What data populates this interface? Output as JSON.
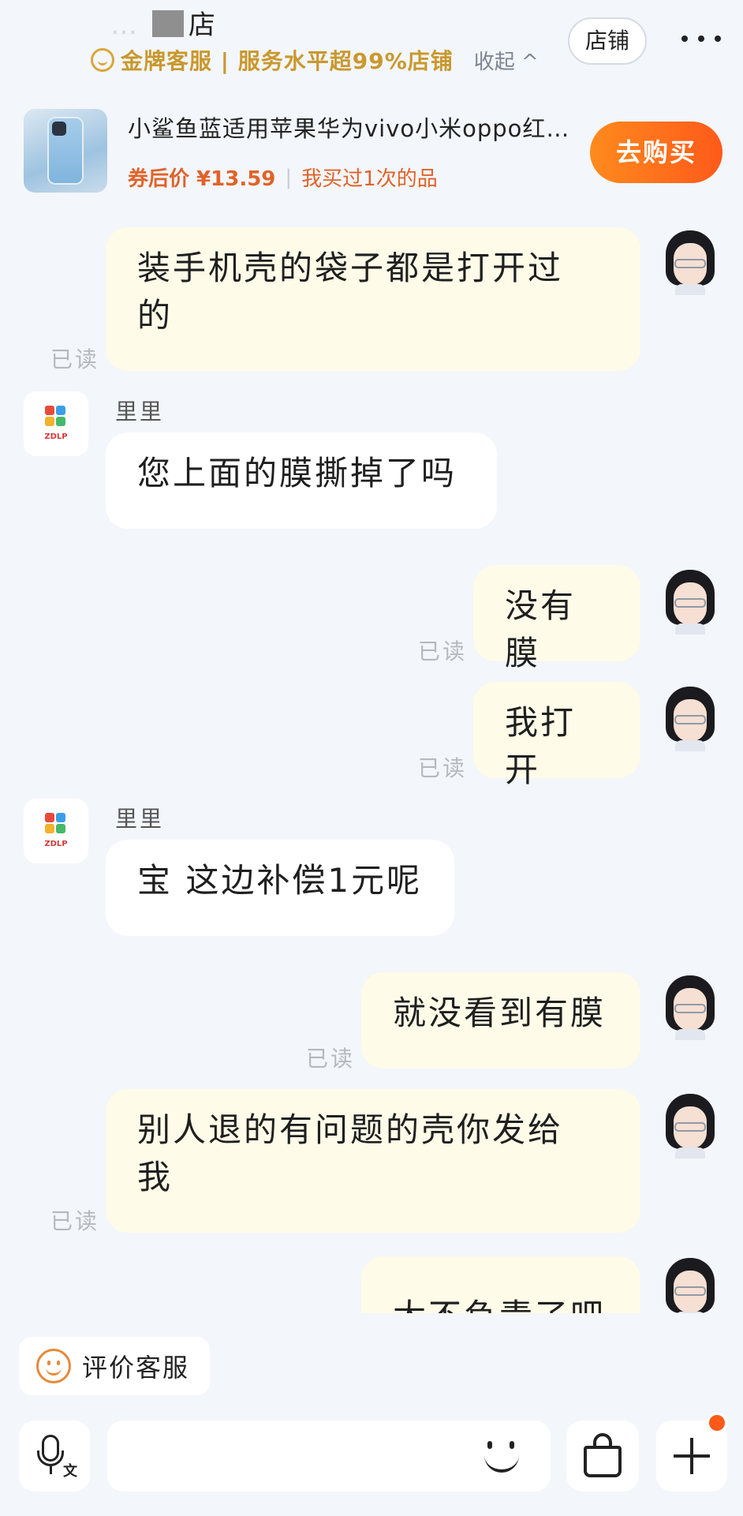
{
  "header": {
    "store_name_suffix": "店",
    "badge_text": "金牌客服 | 服务水平超99%店铺",
    "collapse_label": "收起 ^",
    "store_button": "店铺"
  },
  "product": {
    "title": "小鲨鱼蓝适用苹果华为vivo小米oppo红…",
    "price": "券后价 ¥13.59",
    "bought": "我买过1次的品",
    "buy_button": "去购买"
  },
  "messages": [
    {
      "from": "me",
      "lines": [
        "装手机壳的袋子都是打开过",
        "的"
      ],
      "status": "已读"
    },
    {
      "from": "them",
      "sender": "里里",
      "lines": [
        "您上面的膜撕掉了吗"
      ]
    },
    {
      "from": "me",
      "lines": [
        "没有膜"
      ],
      "status": "已读"
    },
    {
      "from": "me",
      "lines": [
        "我打开"
      ],
      "status": "已读"
    },
    {
      "from": "them",
      "sender": "里里",
      "lines": [
        "宝 这边补偿1元呢"
      ]
    },
    {
      "from": "me",
      "lines": [
        "就没看到有膜"
      ],
      "status": "已读"
    },
    {
      "from": "me",
      "lines": [
        "别人退的有问题的壳你发给",
        "我"
      ],
      "status": "已读"
    },
    {
      "from": "me",
      "lines": [
        "太不负责了吧"
      ]
    }
  ],
  "shop_logo_text": "ZDLP",
  "bottom": {
    "rate_button": "评价客服",
    "voice_label": "文"
  },
  "colors": {
    "accent_orange": "#ff5a1a",
    "gold": "#c9982e",
    "my_bubble": "#fefbe8",
    "their_bubble": "#ffffff"
  }
}
